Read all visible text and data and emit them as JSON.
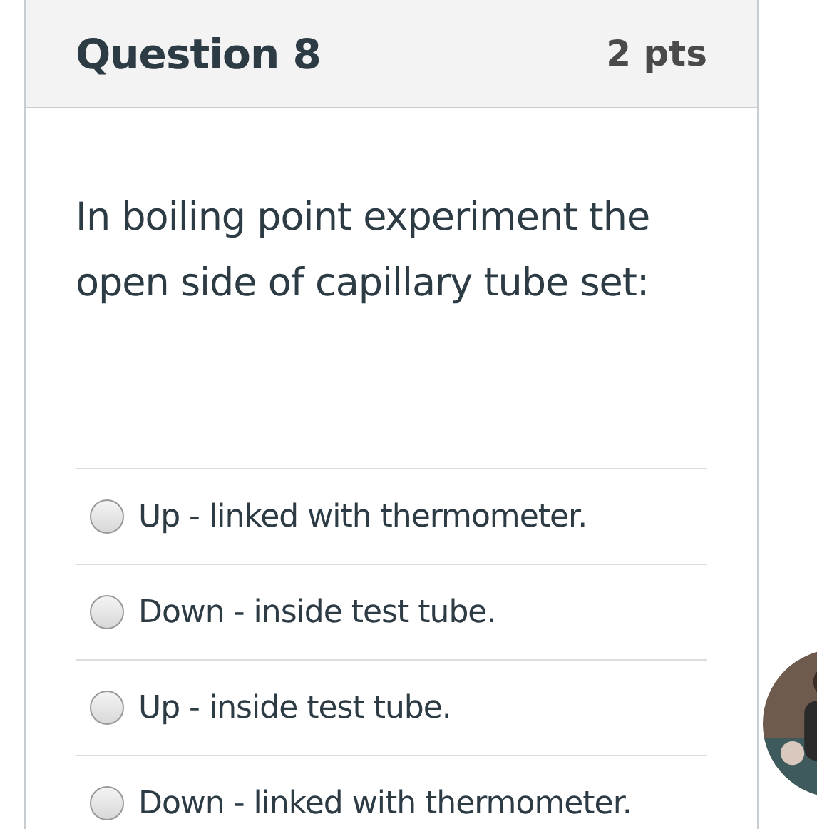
{
  "question": {
    "title": "Question 8",
    "points": "2 pts",
    "text": "In boiling point experiment the open side of capillary tube set:"
  },
  "answers": [
    {
      "label": "Up - linked with thermometer.",
      "selected": false
    },
    {
      "label": "Down - inside test tube.",
      "selected": false
    },
    {
      "label": "Up - inside test tube.",
      "selected": false
    },
    {
      "label": "Down - linked with thermometer.",
      "selected": false
    }
  ]
}
